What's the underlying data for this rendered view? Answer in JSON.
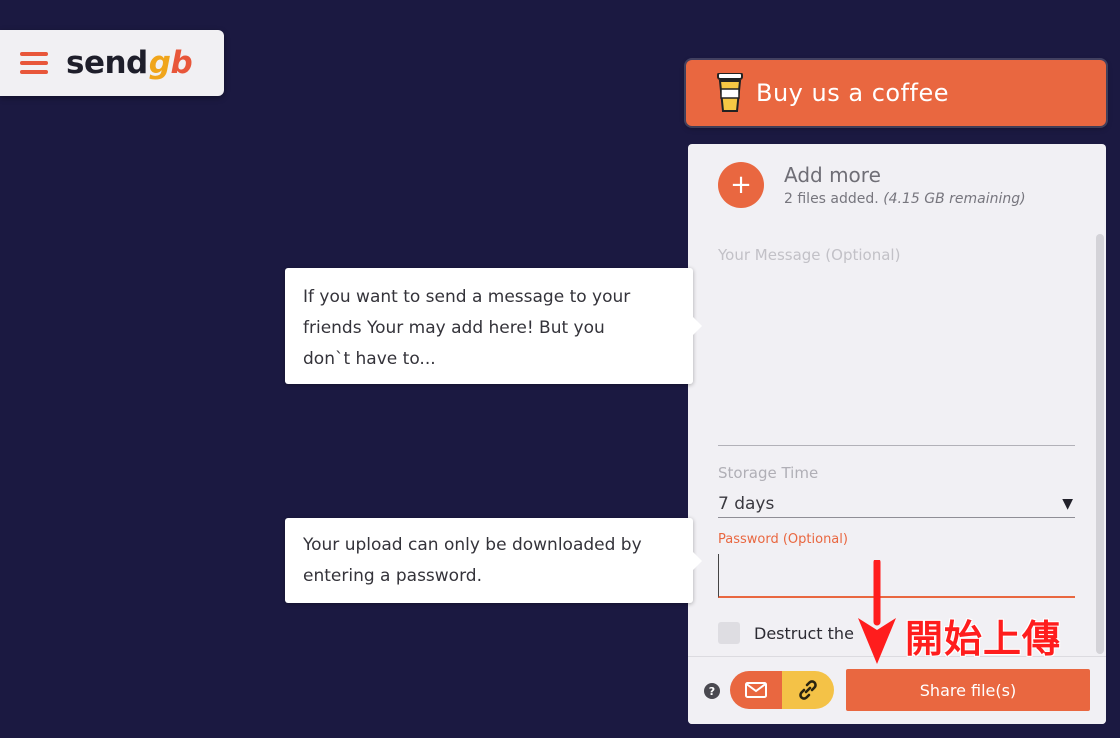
{
  "logo": {
    "name_main": "send",
    "name_g": "g",
    "name_b": "b"
  },
  "coffee": {
    "label": "Buy us a coffee"
  },
  "upload": {
    "add_more": "Add more",
    "files_added": "2 files added.",
    "remaining": "(4.15 GB remaining)"
  },
  "message": {
    "placeholder": "Your Message (Optional)"
  },
  "storage": {
    "label": "Storage Time",
    "value": "7 days"
  },
  "password": {
    "label": "Password (Optional)"
  },
  "destruct": {
    "label": "Destruct the"
  },
  "footer": {
    "help": "?",
    "share_label": "Share file(s)"
  },
  "tooltips": {
    "message_lines": [
      "If you want to send a message to your",
      "friends Your may add here! But you",
      "don`t have to..."
    ],
    "password_lines": [
      "Your upload can only be downloaded by",
      "entering a password."
    ]
  },
  "annotation": {
    "text": "開始上傳"
  },
  "colors": {
    "background": "#1b1941",
    "accent": "#e96740",
    "yellow": "#f4c247",
    "annotation_red": "#ff1d1d"
  }
}
